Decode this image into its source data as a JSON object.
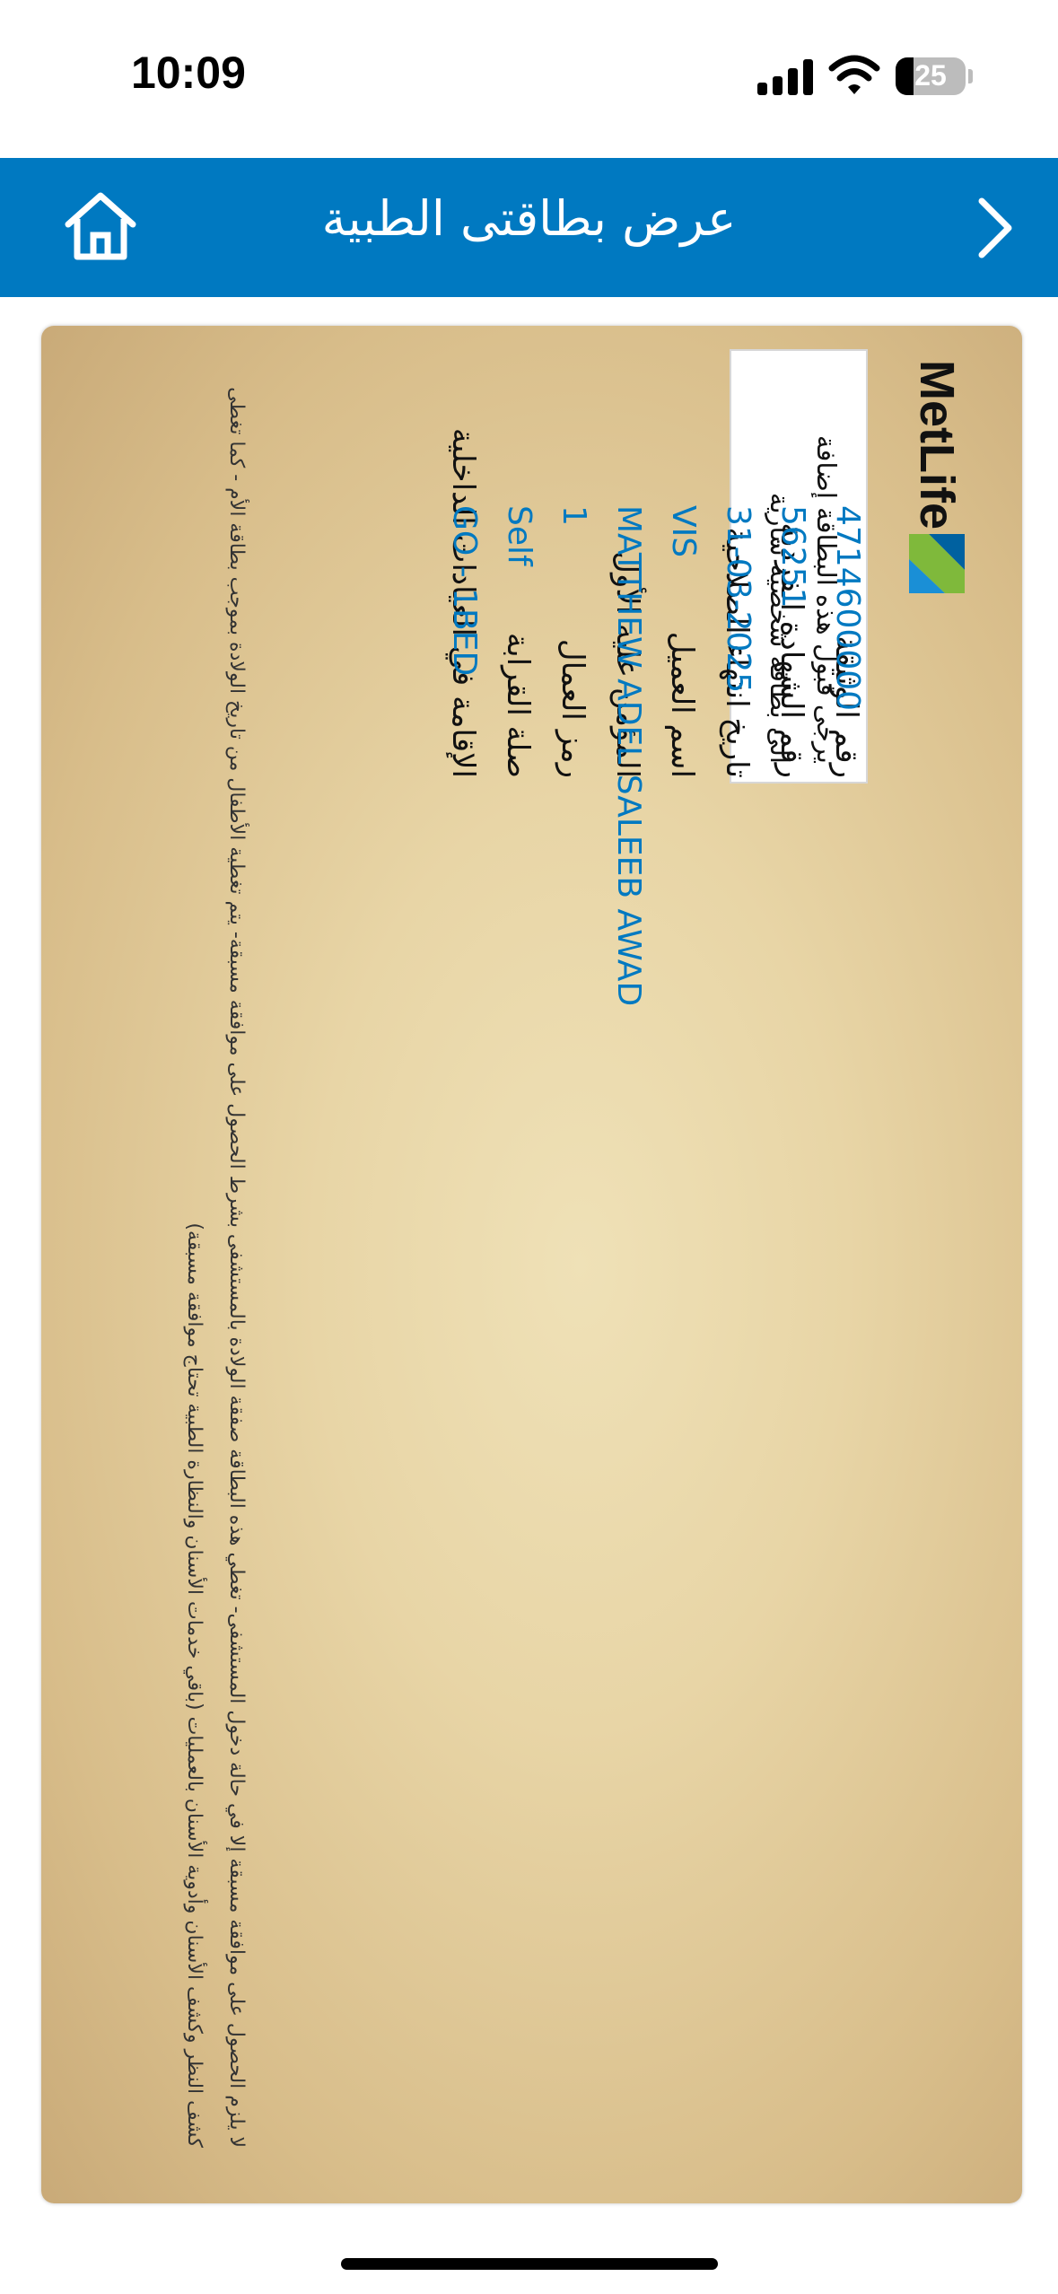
{
  "status_bar": {
    "time": "10:09",
    "battery": "25"
  },
  "header": {
    "title": "عرض بطاقتى الطبية",
    "home_icon": "home-icon",
    "next_icon": "chevron-right-icon"
  },
  "card": {
    "brand": "MetLife",
    "notice": [
      "يرجى قبول هذه البطاقة إضافة",
      "الى بطاقة شخصية سارية"
    ],
    "fields": [
      {
        "label": "رقم الوثيقة",
        "value": "4714600000"
      },
      {
        "label": "رقم الشهادة الفردية",
        "value": "56251"
      },
      {
        "label": "تاريخ انتهاء الصلاحية",
        "value": "31-03-2025"
      },
      {
        "label": "اسم العميل",
        "value": "VIS"
      },
      {
        "label": "المؤمن عليه الأول",
        "value": "MATTHEW ADEL SALEEB AWAD"
      },
      {
        "label": "رمز العمال",
        "value": "1"
      },
      {
        "label": "صلة القرابة",
        "value": "Self"
      },
      {
        "label": "الإقامة في العيادات الداخلية",
        "value": "GO - 1BED"
      }
    ],
    "disclaimer": "لا يلزم الحصول على موافقة مسبقة إلا في حالة دخول المستشفى- تغطي هذه البطاقة صفقة الولادة بالمستشفى بشرط الحصول على موافقة مسبقة- يتم تغطية الأطفال من تاريخ الولادة بموجب بطاقة الأم - كما تغطى كشف النظر وكشف الأسنان وأدوية الأسنان بالعمليات (باقي خدمات الأسنان والنظارة الطبية تحتاج موافقة مسبقة)"
  }
}
